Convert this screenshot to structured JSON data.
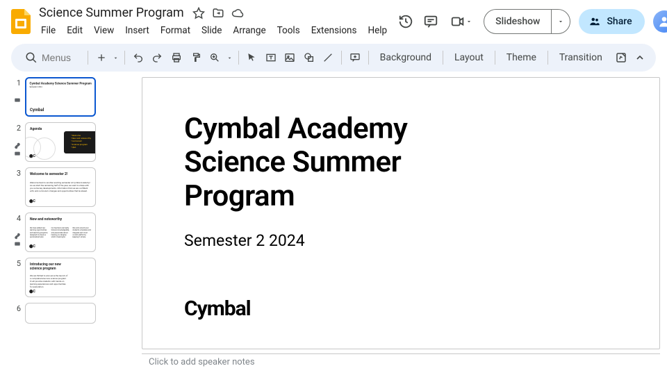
{
  "doc": {
    "title": "Science Summer Program"
  },
  "menus": [
    "File",
    "Edit",
    "View",
    "Insert",
    "Format",
    "Slide",
    "Arrange",
    "Tools",
    "Extensions",
    "Help"
  ],
  "header": {
    "slideshow": "Slideshow",
    "share": "Share"
  },
  "toolbar": {
    "search_placeholder": "Menus",
    "buttons": {
      "background": "Background",
      "layout": "Layout",
      "theme": "Theme",
      "transition": "Transition"
    }
  },
  "thumbs": [
    {
      "num": "1",
      "title": "Cymbal Academy Science Summer Program",
      "sub": "Semester 2 2024",
      "brand": "Cymbal"
    },
    {
      "num": "2",
      "title": "Agenda"
    },
    {
      "num": "3",
      "title": "Welcome to semester 2!"
    },
    {
      "num": "4",
      "title": "New and noteworthy"
    },
    {
      "num": "5",
      "title": "Introducing our new science program"
    },
    {
      "num": "6",
      "title": ""
    }
  ],
  "slide": {
    "title_l1": "Cymbal Academy",
    "title_l2": "Science Summer",
    "title_l3": "Program",
    "subtitle": "Semester 2 2024",
    "brand": "Cymbal"
  },
  "notes": {
    "placeholder": "Click to add speaker notes"
  }
}
